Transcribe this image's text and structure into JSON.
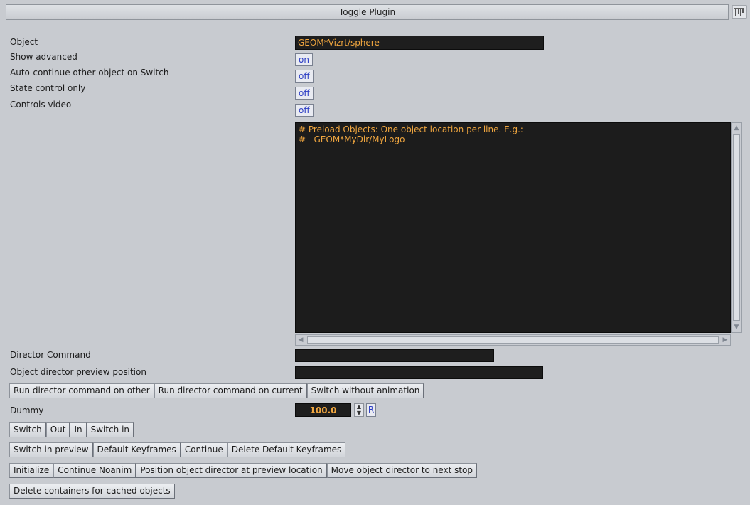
{
  "window": {
    "title": "Toggle Plugin",
    "corner_icon": "plugin-logo-icon"
  },
  "fields": {
    "object_label": "Object",
    "object_value": "GEOM*Vizrt/sphere",
    "show_advanced_label": "Show advanced",
    "show_advanced_value": "on",
    "auto_continue_label": "Auto-continue other object on Switch",
    "auto_continue_value": "off",
    "state_control_label": "State control only",
    "state_control_value": "off",
    "controls_video_label": "Controls video",
    "controls_video_value": "off",
    "preload_lines": [
      "# Preload Objects: One object location per line. E.g.:",
      "#   GEOM*MyDir/MyLogo"
    ],
    "director_command_label": "Director Command",
    "director_command_value": "",
    "preview_position_label": "Object director preview position",
    "preview_position_value": "",
    "dummy_label": "Dummy",
    "dummy_value": "100.0",
    "reset_label": "R"
  },
  "buttons": {
    "row1": [
      "Run director command on other",
      "Run director command on current",
      "Switch without animation"
    ],
    "row2": [
      "Switch",
      "Out",
      "In",
      "Switch in"
    ],
    "row3": [
      "Switch in preview",
      "Default Keyframes",
      "Continue",
      "Delete Default Keyframes"
    ],
    "row4": [
      "Initialize",
      "Continue Noanim",
      "Position object director at preview location",
      "Move object director to next stop"
    ],
    "row5": [
      "Delete containers for cached objects"
    ]
  },
  "colors": {
    "background": "#c8cbd0",
    "field_bg": "#1e1e1e",
    "field_text": "#f0a63f",
    "toggle_text": "#2b3cc4"
  }
}
